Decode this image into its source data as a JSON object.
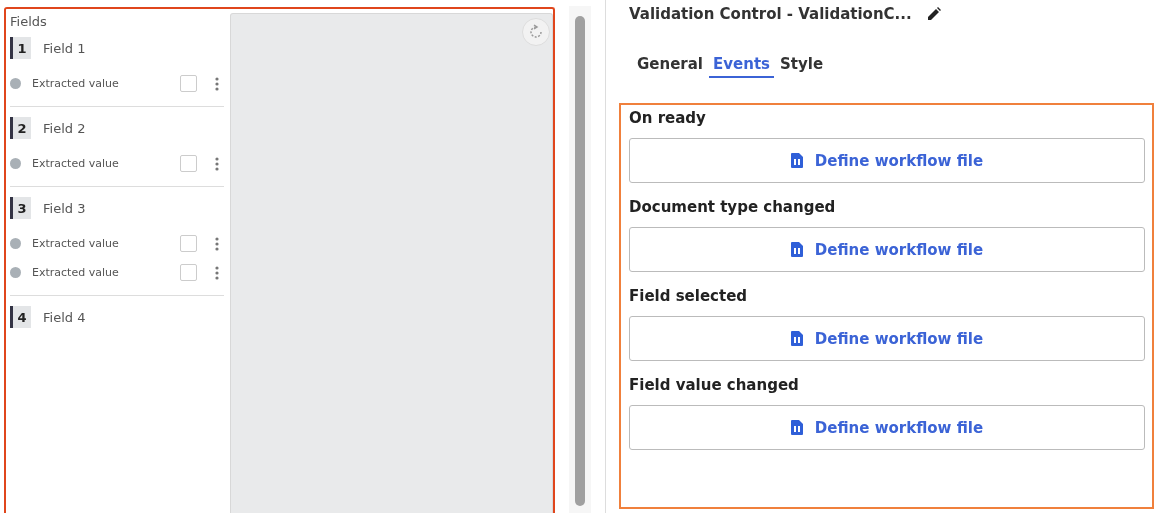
{
  "fields_panel": {
    "title": "Fields",
    "fields": [
      {
        "number": "1",
        "name": "Field 1",
        "values": [
          {
            "text": "Extracted value",
            "checked": false
          }
        ]
      },
      {
        "number": "2",
        "name": "Field 2",
        "values": [
          {
            "text": "Extracted value",
            "checked": false
          }
        ]
      },
      {
        "number": "3",
        "name": "Field 3",
        "values": [
          {
            "text": "Extracted value",
            "checked": false
          },
          {
            "text": "Extracted value",
            "checked": false
          }
        ]
      },
      {
        "number": "4",
        "name": "Field 4"
      }
    ]
  },
  "properties": {
    "title": "Validation Control - ValidationC...",
    "tabs": [
      {
        "label": "General",
        "selected": false
      },
      {
        "label": "Events",
        "selected": true
      },
      {
        "label": "Style",
        "selected": false
      }
    ],
    "events": [
      {
        "label": "On ready",
        "button": "Define workflow file"
      },
      {
        "label": "Document type changed",
        "button": "Define workflow file"
      },
      {
        "label": "Field selected",
        "button": "Define workflow file"
      },
      {
        "label": "Field value changed",
        "button": "Define workflow file"
      }
    ]
  }
}
